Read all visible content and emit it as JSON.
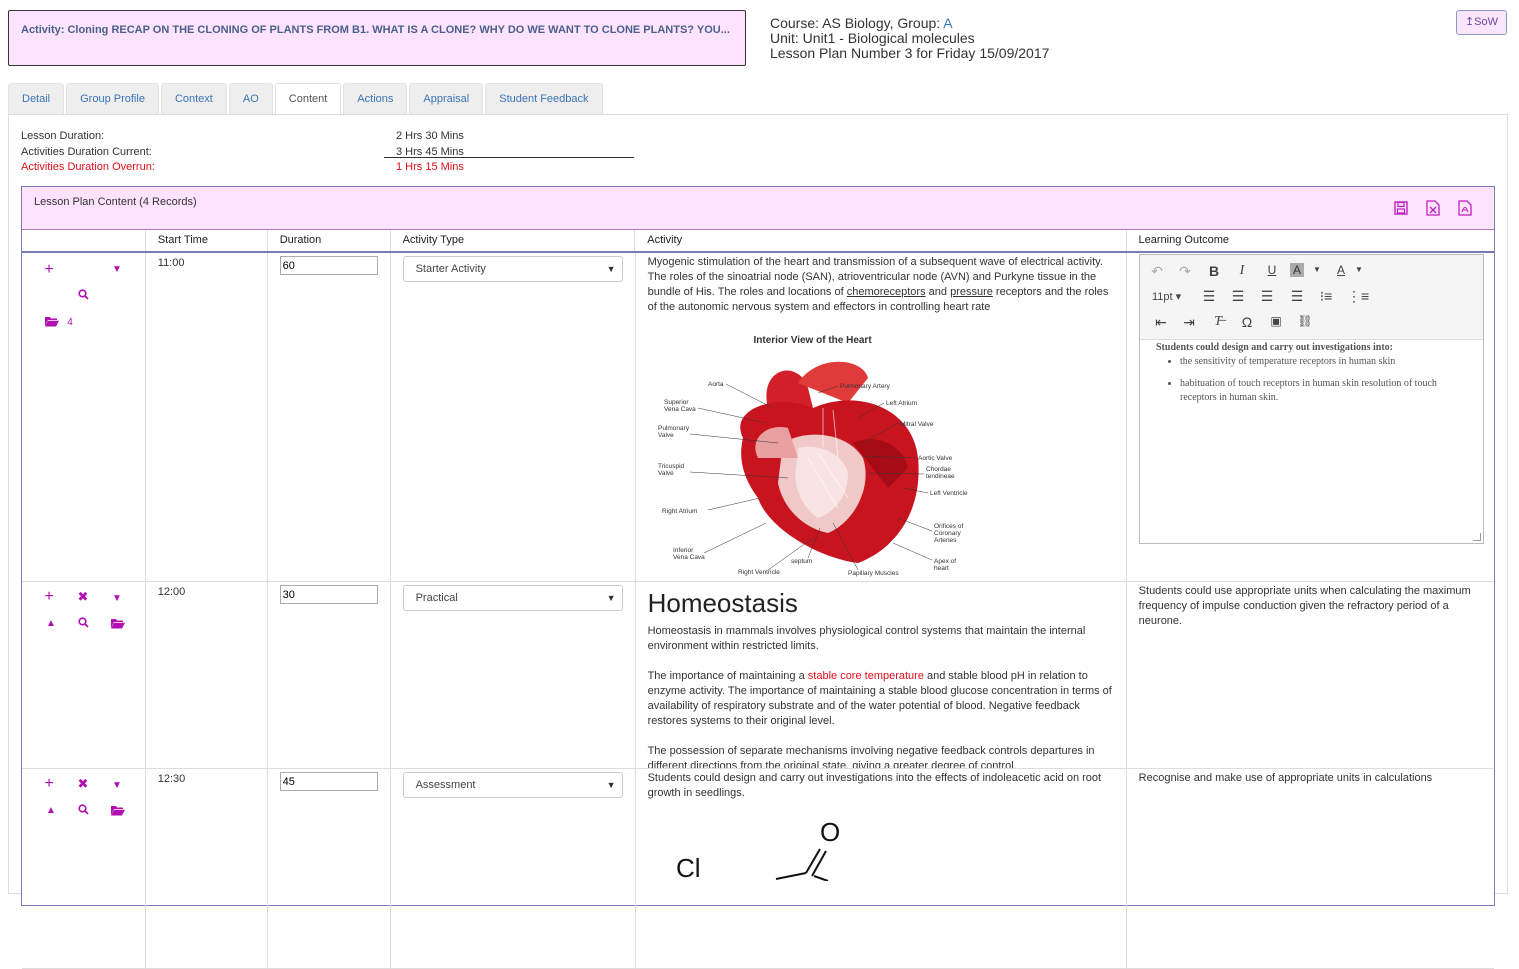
{
  "activity": {
    "text": "Activity: Cloning RECAP ON THE CLONING OF PLANTS FROM B1. WHAT IS A CLONE? WHY DO WE WANT TO CLONE PLANTS? YOU..."
  },
  "course": {
    "course_prefix": "Course: AS Biology, Group: ",
    "group": "A",
    "unit": "Unit: Unit1 - Biological molecules",
    "lesson": "Lesson Plan Number 3 for Friday 15/09/2017"
  },
  "sow_button": "↥SoW",
  "tabs": [
    {
      "label": "Detail"
    },
    {
      "label": "Group Profile"
    },
    {
      "label": "Context"
    },
    {
      "label": "AO"
    },
    {
      "label": "Content"
    },
    {
      "label": "Actions"
    },
    {
      "label": "Appraisal"
    },
    {
      "label": "Student Feedback"
    }
  ],
  "summary": {
    "lesson_duration_label": "Lesson Duration:",
    "lesson_duration_value": "2 Hrs 30 Mins",
    "current_label": "Activities Duration Current:",
    "current_value": "3 Hrs 45 Mins",
    "overrun_label": "Activities Duration Overrun:",
    "overrun_value": "1 Hrs 15 Mins"
  },
  "grid": {
    "title": "Lesson Plan Content (4 Records)",
    "columns": [
      "",
      "Start Time",
      "Duration",
      "Activity Type",
      "Activity",
      "Learning Outcome"
    ],
    "rows": [
      {
        "start": "11:00",
        "duration": "60",
        "type": "Starter Activity",
        "resource_count": "4",
        "activity_parts": {
          "a": "Myogenic stimulation of the heart and transmission of a subsequent wave of electrical activity. The roles of the sinoatrial node (SAN), atrioventricular node (AVN) and Purkyne tissue in the bundle of His. The roles and locations of ",
          "b": "chemoreceptors",
          "c": " and ",
          "d": "pressure",
          "e": " receptors and the roles of the autonomic nervous system and effectors in controlling heart rate"
        },
        "image_title": "Interior View of the Heart",
        "heart_labels": [
          "Aorta",
          "Superior Vena Cava",
          "Pulmonary Valve",
          "Tricuspid Valve",
          "Right Atrium",
          "Inferior Vena Cava",
          "Right Ventricle",
          "septum",
          "Papillary Muscles",
          "Apex of heart",
          "Orifices of Coronary Arteries",
          "Left Ventricle",
          "Chordae tendineae",
          "Aortic Valve",
          "Mitral Valve",
          "Left Atrium",
          "Pulmonary Artery"
        ],
        "editor": {
          "font_size": "11pt",
          "heading": "Students could design and carry out investigations into:",
          "bullets": [
            "the sensitivity of temperature receptors in human skin",
            "habituation of touch receptors in human skin resolution of touch receptors in human skin."
          ]
        }
      },
      {
        "start": "12:00",
        "duration": "30",
        "type": "Practical",
        "heading": "Homeostasis",
        "p1": "Homeostasis in mammals involves physiological control systems that maintain the internal environment within restricted limits.",
        "p2a": "The importance of maintaining a ",
        "p2b": "stable core temperature",
        "p2c": " and stable blood pH in relation to enzyme activity. The importance of maintaining a stable blood glucose concentration in terms of availability of respiratory substrate and of the water potential of blood. Negative feedback restores systems to their original level.",
        "p3": "The possession of separate mechanisms involving negative feedback controls departures in different directions from the original state, giving a greater degree of control.",
        "outcome": "Students could use appropriate units when calculating the maximum frequency of impulse conduction given the refractory period of a neurone."
      },
      {
        "start": "12:30",
        "duration": "45",
        "type": "Assessment",
        "activity": "Students could design and carry out investigations into the effects of indoleacetic acid on root growth in seedlings.",
        "chem_o": "O",
        "chem_cl": "Cl",
        "outcome": "Recognise and make use of appropriate units in calculations"
      }
    ]
  },
  "colors": {
    "accent": "#b010b0",
    "header_bg": "#fde3fd",
    "link": "#3a73b8",
    "overrun": "#e0101a"
  }
}
